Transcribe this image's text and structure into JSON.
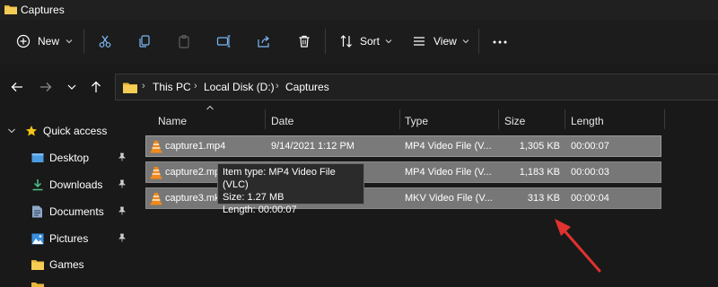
{
  "window": {
    "title": "Captures"
  },
  "toolbar": {
    "new_label": "New",
    "sort_label": "Sort",
    "view_label": "View",
    "icons": [
      "cut-icon",
      "copy-icon",
      "paste-icon",
      "rename-icon",
      "share-icon",
      "delete-icon"
    ]
  },
  "address": {
    "crumbs": [
      "This PC",
      "Local Disk (D:)",
      "Captures"
    ]
  },
  "sidebar": {
    "items": [
      {
        "label": "Quick access",
        "icon": "star-icon"
      },
      {
        "label": "Desktop",
        "icon": "desktop-icon",
        "pinned": true
      },
      {
        "label": "Downloads",
        "icon": "download-icon",
        "pinned": true
      },
      {
        "label": "Documents",
        "icon": "document-icon",
        "pinned": true
      },
      {
        "label": "Pictures",
        "icon": "picture-icon",
        "pinned": true
      },
      {
        "label": "Games",
        "icon": "folder-icon",
        "pinned": false
      }
    ]
  },
  "columns": {
    "name": "Name",
    "date": "Date",
    "type": "Type",
    "size": "Size",
    "length": "Length"
  },
  "files": [
    {
      "name": "capture1.mp4",
      "date": "9/14/2021 1:12 PM",
      "type": "MP4 Video File (V...",
      "size": "1,305 KB",
      "length": "00:00:07"
    },
    {
      "name": "capture2.mp",
      "date": "",
      "type": "MP4 Video File (V...",
      "size": "1,183 KB",
      "length": "00:00:03"
    },
    {
      "name": "capture3.mk",
      "date": "",
      "type": "MKV Video File (V...",
      "size": "313 KB",
      "length": "00:00:04"
    }
  ],
  "tooltip": {
    "line1": "Item type: MP4 Video File (VLC)",
    "line2": "Size: 1.27 MB",
    "line3": "Length: 00:00:07"
  },
  "colors": {
    "accent_folder": "#f2c94c",
    "annotation_arrow": "#e0322f",
    "vlc_orange": "#f08a1c"
  }
}
